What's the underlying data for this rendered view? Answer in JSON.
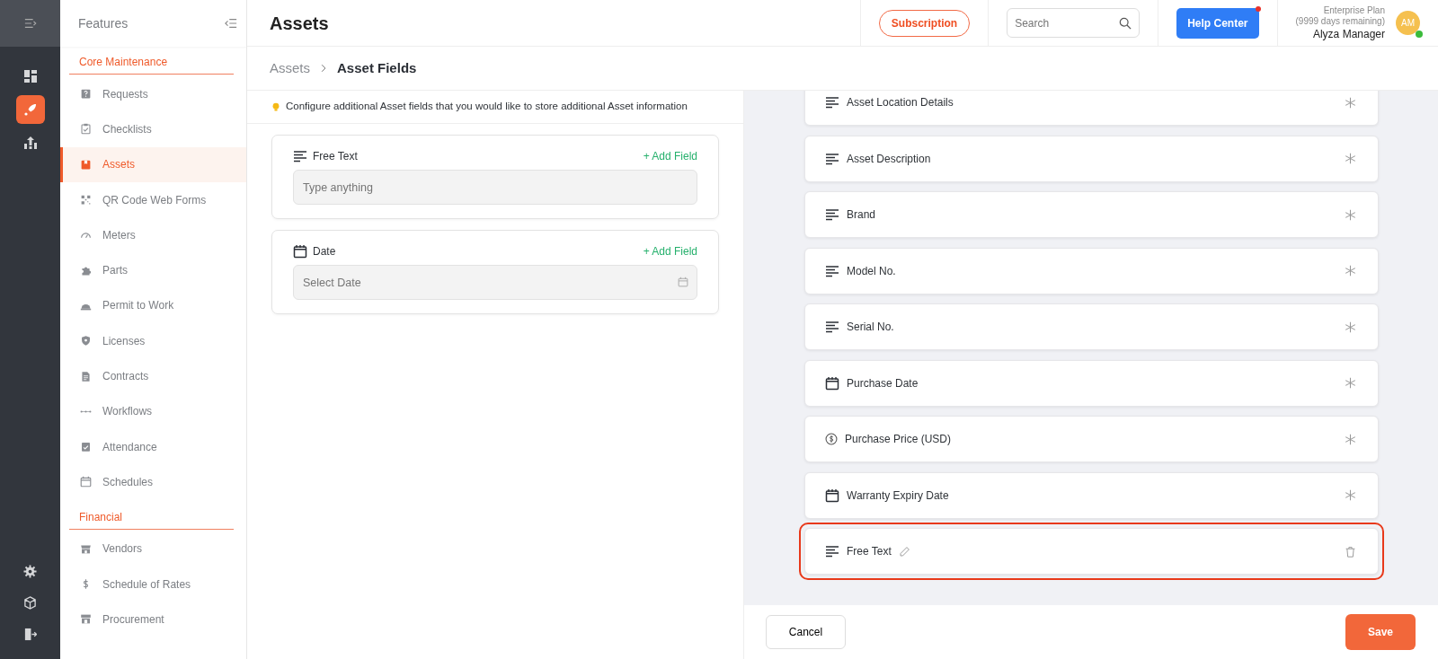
{
  "rail": {
    "items": [
      {
        "selected": false
      },
      {
        "selected": true
      },
      {
        "selected": false
      }
    ]
  },
  "sidebar": {
    "title": "Features",
    "sections": [
      {
        "title": "Core Maintenance",
        "items": [
          {
            "label": "Requests",
            "selected": false
          },
          {
            "label": "Checklists",
            "selected": false
          },
          {
            "label": "Assets",
            "selected": true
          },
          {
            "label": "QR Code Web Forms",
            "selected": false
          },
          {
            "label": "Meters",
            "selected": false
          },
          {
            "label": "Parts",
            "selected": false
          },
          {
            "label": "Permit to Work",
            "selected": false
          },
          {
            "label": "Licenses",
            "selected": false
          },
          {
            "label": "Contracts",
            "selected": false
          },
          {
            "label": "Workflows",
            "selected": false
          },
          {
            "label": "Attendance",
            "selected": false
          },
          {
            "label": "Schedules",
            "selected": false
          }
        ]
      },
      {
        "title": "Financial",
        "items": [
          {
            "label": "Vendors",
            "selected": false
          },
          {
            "label": "Schedule of Rates",
            "selected": false
          },
          {
            "label": "Procurement",
            "selected": false
          }
        ]
      }
    ]
  },
  "header": {
    "title": "Assets",
    "subscription": "Subscription",
    "search": {
      "placeholder": "Search"
    },
    "help": "Help Center",
    "help_notification": true,
    "plan": "Enterprise Plan",
    "days": "(9999 days remaining)",
    "user": "Alyza Manager",
    "avatar": "AM",
    "online": true
  },
  "breadcrumb": [
    {
      "label": "Assets",
      "current": false
    },
    {
      "label": "Asset Fields",
      "current": true
    }
  ],
  "info": "Configure additional Asset fields that you would like to store additional Asset information",
  "field_types": [
    {
      "kind": "text",
      "label": "Free Text",
      "action": "+ Add Field",
      "placeholder": "Type anything"
    },
    {
      "kind": "date",
      "label": "Date",
      "action": "+ Add Field",
      "placeholder": "Select Date"
    }
  ],
  "fields": [
    {
      "kind": "text",
      "label": "Asset Location Details",
      "removable": false,
      "highlighted": false
    },
    {
      "kind": "text",
      "label": "Asset Description",
      "removable": false,
      "highlighted": false
    },
    {
      "kind": "text",
      "label": "Brand",
      "removable": false,
      "highlighted": false
    },
    {
      "kind": "text",
      "label": "Model No.",
      "removable": false,
      "highlighted": false
    },
    {
      "kind": "text",
      "label": "Serial No.",
      "removable": false,
      "highlighted": false
    },
    {
      "kind": "date",
      "label": "Purchase Date",
      "removable": false,
      "highlighted": false
    },
    {
      "kind": "currency",
      "label": "Purchase Price (USD)",
      "removable": false,
      "highlighted": false
    },
    {
      "kind": "date",
      "label": "Warranty Expiry Date",
      "removable": false,
      "highlighted": false
    },
    {
      "kind": "text",
      "label": "Free Text",
      "removable": true,
      "highlighted": true
    }
  ],
  "footer": {
    "cancel": "Cancel",
    "save": "Save"
  }
}
